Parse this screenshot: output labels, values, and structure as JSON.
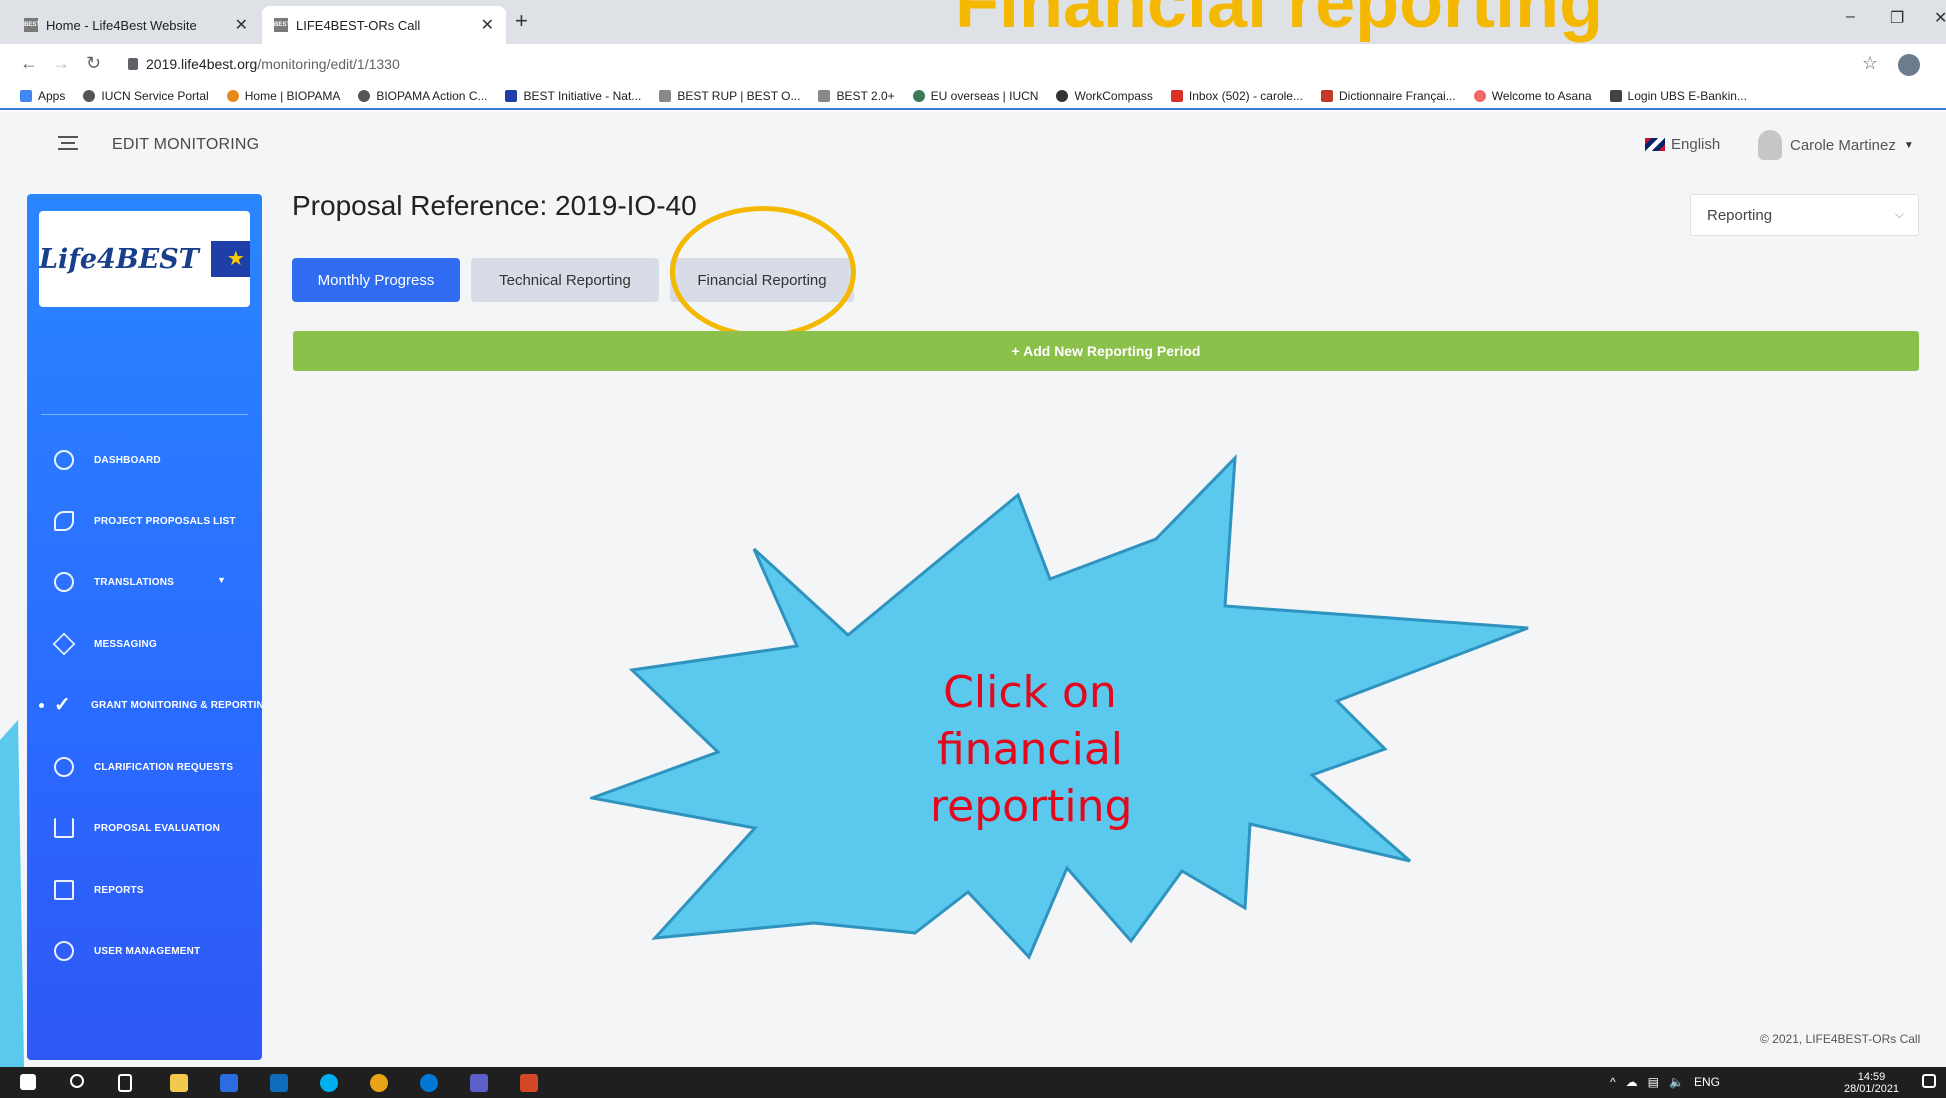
{
  "browser": {
    "tabs": [
      {
        "title": "Home - Life4Best Website",
        "favicon": "BEST",
        "active": false
      },
      {
        "title": "LIFE4BEST-ORs Call",
        "favicon": "BEST",
        "active": true
      }
    ],
    "new_tab": "+",
    "url_host": "2019.life4best.org",
    "url_path": "/monitoring/edit/1/1330",
    "window_controls": [
      "–",
      "❐",
      "✕"
    ],
    "bookmarks": [
      {
        "label": "Apps",
        "icon": "apps-grid-icon"
      },
      {
        "label": "IUCN Service Portal",
        "icon": "globe-icon"
      },
      {
        "label": "Home | BIOPAMA",
        "icon": "biopama-icon"
      },
      {
        "label": "BIOPAMA Action C...",
        "icon": "globe-icon"
      },
      {
        "label": "BEST Initiative - Nat...",
        "icon": "eu-icon"
      },
      {
        "label": "BEST RUP | BEST O...",
        "icon": "best-icon"
      },
      {
        "label": "BEST 2.0+",
        "icon": "best-icon"
      },
      {
        "label": "EU overseas | IUCN",
        "icon": "iucn-icon"
      },
      {
        "label": "WorkCompass",
        "icon": "workcompass-icon"
      },
      {
        "label": "Inbox (502) - carole...",
        "icon": "gmail-icon"
      },
      {
        "label": "Dictionnaire Françai...",
        "icon": "wr-icon"
      },
      {
        "label": "Welcome to Asana",
        "icon": "asana-icon"
      },
      {
        "label": "Login UBS E-Bankin...",
        "icon": "ubs-icon"
      }
    ]
  },
  "overlay": {
    "headline": "Financial reporting",
    "callout_lines": [
      "Click on",
      "financial",
      "reporting"
    ]
  },
  "app": {
    "header_title": "EDIT MONITORING",
    "language": "English",
    "user_name": "Carole Martinez",
    "logo_text": "Life4BEST",
    "sidebar": [
      {
        "label": "DASHBOARD",
        "icon": "dashboard-icon"
      },
      {
        "label": "PROJECT PROPOSALS LIST",
        "icon": "paperclip-icon"
      },
      {
        "label": "TRANSLATIONS",
        "icon": "chat-icon",
        "has_dropdown": true
      },
      {
        "label": "MESSAGING",
        "icon": "send-icon"
      },
      {
        "label": "GRANT MONITORING & REPORTING",
        "icon": "check-icon",
        "active": true
      },
      {
        "label": "CLARIFICATION REQUESTS",
        "icon": "info-icon"
      },
      {
        "label": "PROPOSAL EVALUATION",
        "icon": "bar-chart-icon"
      },
      {
        "label": "REPORTS",
        "icon": "report-icon"
      },
      {
        "label": "USER MANAGEMENT",
        "icon": "user-icon"
      }
    ],
    "proposal_reference": "Proposal Reference: 2019-IO-40",
    "tabs": [
      "Monthly Progress",
      "Technical Reporting",
      "Financial Reporting"
    ],
    "reporting_select": "Reporting",
    "add_period_label": "+ Add New Reporting Period",
    "footer": "© 2021, LIFE4BEST-ORs Call"
  },
  "taskbar": {
    "language": "ENG",
    "time": "14:59",
    "date": "28/01/2021"
  },
  "colors": {
    "sidebar": "#2a6bff",
    "primary_tab": "#2f6cf2",
    "add_bar": "#8bc04a",
    "highlight": "#f5b800",
    "burst_fill": "#5bc8ee",
    "callout_text": "#e3081b"
  }
}
